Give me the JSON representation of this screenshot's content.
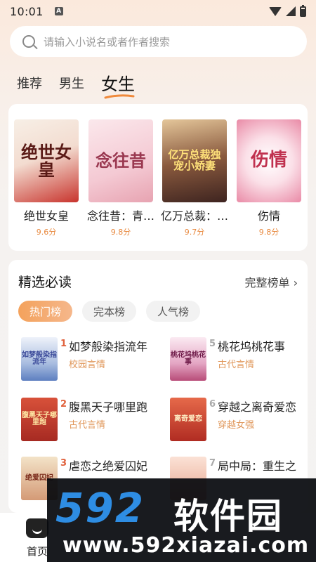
{
  "status": {
    "time": "10:01",
    "notif": "A"
  },
  "search": {
    "placeholder": "请输入小说名或者作者搜索"
  },
  "tabs": [
    {
      "label": "推荐"
    },
    {
      "label": "男生"
    },
    {
      "label": "女生"
    }
  ],
  "featured": [
    {
      "title": "绝世女皇",
      "score": "9.6分",
      "cover_text": "绝世女皇",
      "cover_color": "#b8322c"
    },
    {
      "title": "念往昔：青…",
      "score": "9.8分",
      "cover_text": "念往昔",
      "cover_color": "#d98a9a"
    },
    {
      "title": "亿万总裁：…",
      "score": "9.7分",
      "cover_text": "亿万总裁独宠小娇妻",
      "cover_color": "#5a3b2e"
    },
    {
      "title": "伤情",
      "score": "9.8分",
      "cover_text": "伤情",
      "cover_color": "#e58aa6"
    }
  ],
  "picks": {
    "title": "精选必读",
    "more": "完整榜单 ›",
    "pills": [
      "热门榜",
      "完本榜",
      "人气榜"
    ],
    "items": [
      {
        "rank": "1",
        "title": "如梦般染指流年",
        "genre": "校园言情",
        "cover_color": "#7f9fd0",
        "cover_text": "如梦般染指流年"
      },
      {
        "rank": "2",
        "title": "腹黑天子哪里跑",
        "genre": "古代言情",
        "cover_color": "#c43b2c",
        "cover_text": "腹黑天子哪里跑"
      },
      {
        "rank": "3",
        "title": "虐恋之绝爱囚妃",
        "genre": "",
        "cover_color": "#d2936f",
        "cover_text": "绝爱囚妃"
      },
      {
        "rank": "5",
        "title": "桃花坞桃花事",
        "genre": "古代言情",
        "cover_color": "#b84c78",
        "cover_text": "桃花坞桃花事"
      },
      {
        "rank": "6",
        "title": "穿越之离奇爱恋",
        "genre": "穿越女强",
        "cover_color": "#c1382a",
        "cover_text": "离奇爱恋"
      },
      {
        "rank": "7",
        "title": "局中局：重生之",
        "genre": "",
        "cover_color": "#e7a58f",
        "cover_text": ""
      }
    ]
  },
  "nav": {
    "home_label": "首页"
  },
  "watermark": {
    "brand_num": "592",
    "brand_cn": "软件园",
    "url": "www.592xiazai.com"
  }
}
